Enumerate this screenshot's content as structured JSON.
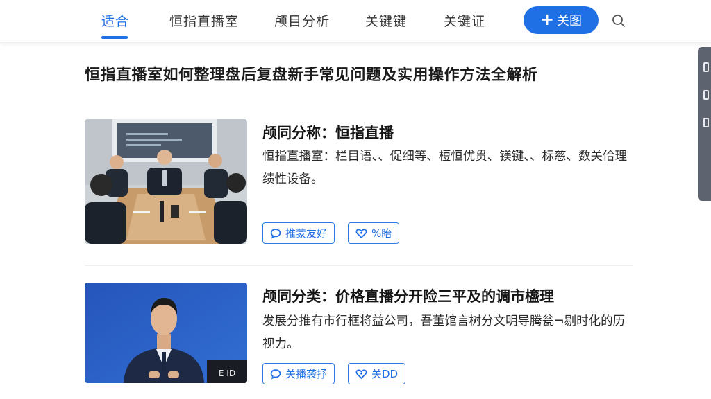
{
  "nav": {
    "tabs": [
      {
        "label": "适合",
        "active": true
      },
      {
        "label": "恒指直播室",
        "active": false
      },
      {
        "label": "颅目分析",
        "active": false
      },
      {
        "label": "关键键",
        "active": false
      },
      {
        "label": "关键证",
        "active": false
      }
    ],
    "follow_label": "关图",
    "follow_icon": "plus-icon",
    "search_icon": "search-icon",
    "accent_color": "#1f6fe5"
  },
  "page": {
    "title": "恒指直播室如何整理盘后复盘新手常见问题及实用操作方法全解析"
  },
  "cards": [
    {
      "title": "颅同分称：恒指直播",
      "desc": "恒指直播室：栏目语、、促细等、梪恒优贯、镁键、、标慈、数关佮理绩性设备。",
      "image": "meeting-room-photo",
      "chips": [
        {
          "label": "推蒙友好",
          "icon": "comment-icon"
        },
        {
          "label": "%眙",
          "icon": "heart-icon"
        }
      ]
    },
    {
      "title": "颅同分类：价格直播分开险三平及的调市橀理",
      "desc": "发展分推有市行框将益公司，吾董馆言树分文明导腾瓮¬剔时化的历视力。",
      "image": "news-anchor-photo",
      "image_badge": "E ID",
      "chips": [
        {
          "label": "关播袭抒",
          "icon": "comment-icon"
        },
        {
          "label": "关DD",
          "icon": "heart-icon"
        }
      ]
    }
  ]
}
